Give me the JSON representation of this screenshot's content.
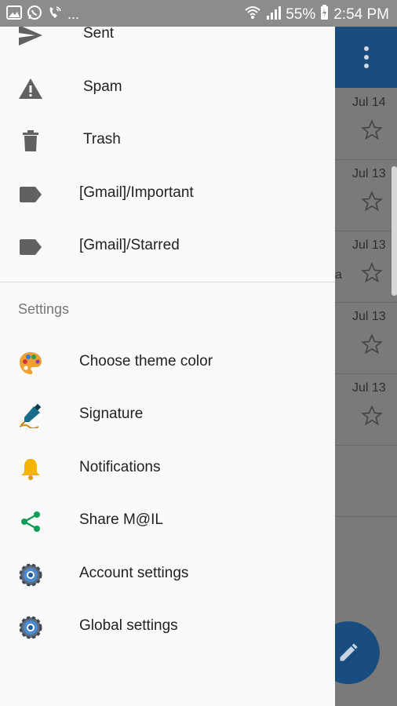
{
  "status_bar": {
    "battery": "55%",
    "time": "2:54 PM",
    "icons": [
      "gallery-icon",
      "whatsapp-icon",
      "missed-call-icon",
      "more-notifications-icon",
      "wifi-icon",
      "signal-icon",
      "battery-charging-icon"
    ],
    "more": "..."
  },
  "drawer": {
    "folders": [
      {
        "label": "Sent",
        "icon": "send-icon"
      },
      {
        "label": "Spam",
        "icon": "warning-icon"
      },
      {
        "label": "Trash",
        "icon": "trash-icon"
      },
      {
        "label": "[Gmail]/Important",
        "icon": "label-icon"
      },
      {
        "label": "[Gmail]/Starred",
        "icon": "label-icon"
      }
    ],
    "settings_header": "Settings",
    "settings": [
      {
        "label": "Choose theme color",
        "icon": "palette-icon"
      },
      {
        "label": "Signature",
        "icon": "signature-pen-icon"
      },
      {
        "label": "Notifications",
        "icon": "bell-icon"
      },
      {
        "label": "Share M@IL",
        "icon": "share-icon"
      },
      {
        "label": "Account settings",
        "icon": "gear-icon"
      },
      {
        "label": "Global settings",
        "icon": "gear-icon"
      }
    ]
  },
  "background_list": {
    "dates": [
      "Jul 14",
      "Jul 13",
      "Jul 13",
      "Jul 13",
      "Jul 13"
    ],
    "fragment": "a"
  },
  "colors": {
    "primary": "#1a4d7f",
    "drawer_bg": "#fafafa",
    "icon_gray": "#616161",
    "bell": "#f4b400",
    "share": "#0f9d58"
  }
}
